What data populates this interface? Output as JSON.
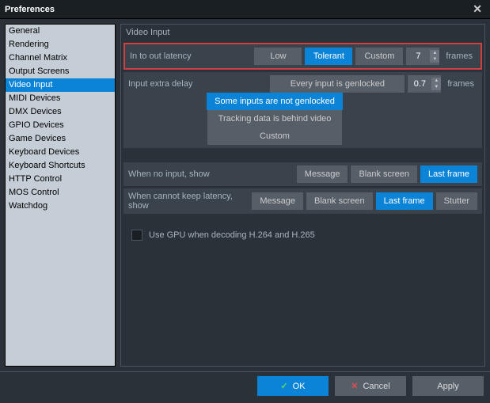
{
  "window": {
    "title": "Preferences"
  },
  "sidebar": {
    "items": [
      "General",
      "Rendering",
      "Channel Matrix",
      "Output Screens",
      "Video Input",
      "MIDI Devices",
      "DMX Devices",
      "GPIO Devices",
      "Game Devices",
      "Keyboard Devices",
      "Keyboard Shortcuts",
      "HTTP Control",
      "MOS Control",
      "Watchdog"
    ],
    "selected": 4
  },
  "panel": {
    "title": "Video Input"
  },
  "latency": {
    "label": "In to out latency",
    "options": [
      "Low",
      "Tolerant",
      "Custom"
    ],
    "selected": 1,
    "value": "7",
    "unit": "frames"
  },
  "extraDelay": {
    "label": "Input extra delay",
    "options": [
      "Every input is genlocked",
      "Some inputs are not genlocked",
      "Tracking data is behind video",
      "Custom"
    ],
    "selected": 1,
    "value": "0.7",
    "unit": "frames"
  },
  "noInput": {
    "label": "When no input, show",
    "options": [
      "Message",
      "Blank screen",
      "Last frame"
    ],
    "selected": 2
  },
  "cannotKeep": {
    "label": "When cannot keep latency, show",
    "options": [
      "Message",
      "Blank screen",
      "Last frame",
      "Stutter"
    ],
    "selected": 2
  },
  "gpu": {
    "label": "Use GPU when decoding H.264 and H.265",
    "checked": false
  },
  "buttons": {
    "ok": "OK",
    "cancel": "Cancel",
    "apply": "Apply"
  }
}
